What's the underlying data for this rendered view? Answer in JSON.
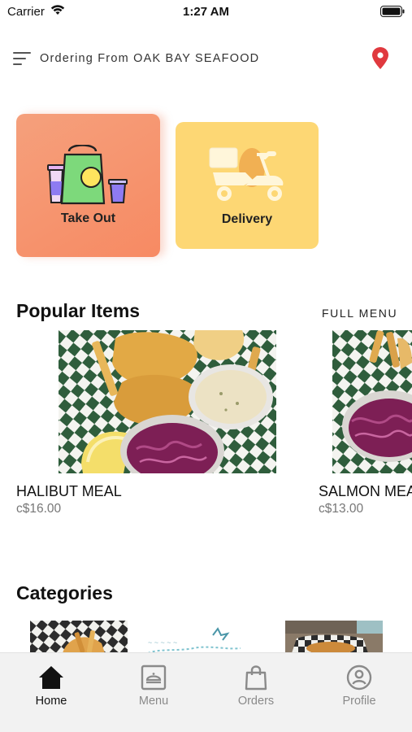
{
  "status_bar": {
    "carrier": "Carrier",
    "time": "1:27 AM"
  },
  "header": {
    "ordering_text": "Ordering From OAK BAY SEAFOOD"
  },
  "order_types": [
    {
      "label": "Take Out",
      "icon": "shopping-bag-icon",
      "color": "#F78A63"
    },
    {
      "label": "Delivery",
      "icon": "scooter-icon",
      "color": "#FDD774"
    }
  ],
  "popular": {
    "title": "Popular Items",
    "full_menu_label": "FULL MENU",
    "items": [
      {
        "name": "HALIBUT MEAL",
        "price": "c$16.00"
      },
      {
        "name": "SALMON MEAL",
        "price": "c$13.00"
      }
    ]
  },
  "categories": {
    "title": "Categories"
  },
  "tabs": [
    {
      "label": "Home",
      "icon": "home-icon",
      "active": true
    },
    {
      "label": "Menu",
      "icon": "menu-dish-icon",
      "active": false
    },
    {
      "label": "Orders",
      "icon": "shopping-bag-icon",
      "active": false
    },
    {
      "label": "Profile",
      "icon": "profile-icon",
      "active": false
    }
  ],
  "colors": {
    "accent_pin": "#E0393E",
    "tab_bar_bg": "#F2F2F2",
    "active_tab": "#111111",
    "inactive_tab": "#8A8A8A"
  }
}
